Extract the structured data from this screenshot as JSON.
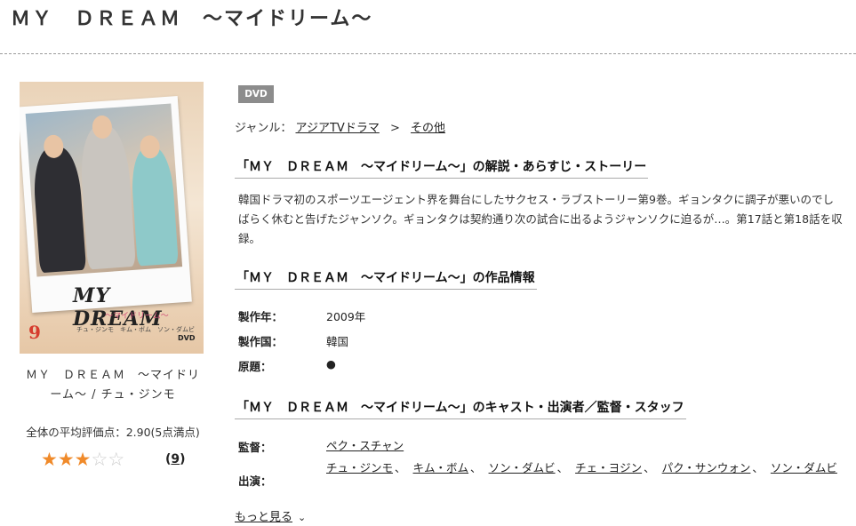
{
  "header": {
    "title": "ＭＹ　ＤＲＥＡＭ　～マイドリーム～"
  },
  "product": {
    "cover_logo": "MY DREAM",
    "cover_subtitle": "〜マイドリーム〜",
    "cover_number": "9",
    "cover_cast": "チュ・ジンモ　キム・ボム　ソン・ダムビ",
    "cover_dvd_mark": "DVD",
    "caption": "ＭＹ　ＤＲＥＡＭ　～マイドリーム～ / チュ・ジンモ",
    "rating_caption": "全体の平均評価点：2.90(5点満点)",
    "rating_value": 2.9,
    "rating_max": 5,
    "stars": [
      "★",
      "★",
      "★",
      "☆",
      "☆"
    ],
    "review_count_open": "(",
    "review_count": "9",
    "review_count_close": ")"
  },
  "detail": {
    "badge": "DVD",
    "genre_label": "ジャンル：",
    "genre_items": [
      "アジアTVドラマ",
      "その他"
    ],
    "genre_separator": ">",
    "synopsis_title": "「ＭＹ　ＤＲＥＡＭ　～マイドリーム～」の解説・あらすじ・ストーリー",
    "synopsis": "韓国ドラマ初のスポーツエージェント界を舞台にしたサクセス・ラブストーリー第9巻。ギョンタクに調子が悪いのでしばらく休むと告げたジャンソク。ギョンタクは契約通り次の試合に出るようジャンソクに迫るが…。第17話と第18話を収録。",
    "info_title": "「ＭＹ　ＤＲＥＡＭ　～マイドリーム～」の作品情報",
    "info": [
      {
        "label": "製作年：",
        "value": "2009年"
      },
      {
        "label": "製作国：",
        "value": "韓国"
      },
      {
        "label": "原題：",
        "value": "●"
      }
    ],
    "cast_title": "「ＭＹ　ＤＲＥＡＭ　～マイドリーム～」のキャスト・出演者／監督・スタッフ",
    "director_label": "監督：",
    "director": "ペク・スチャン",
    "cast_label": "出演：",
    "cast": [
      "チュ・ジンモ",
      "キム・ボム",
      "ソン・ダムビ",
      "チェ・ヨジン",
      "パク・サンウォン",
      "ソン・ダムビ"
    ],
    "cast_separator": "、",
    "more_label": "もっと見る"
  }
}
